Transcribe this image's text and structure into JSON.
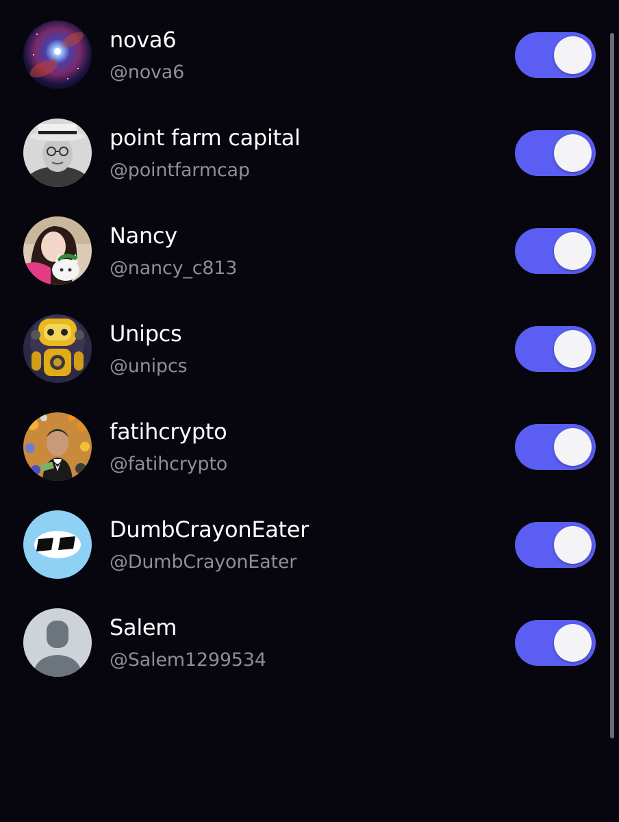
{
  "follows": [
    {
      "name": "nova6",
      "handle": "@nova6",
      "avatar": "galaxy-avatar",
      "enabled": true
    },
    {
      "name": "point farm capital",
      "handle": "@pointfarmcap",
      "avatar": "vintage-portrait-avatar",
      "enabled": true
    },
    {
      "name": "Nancy",
      "handle": "@nancy_c813",
      "avatar": "selfie-with-cat-avatar",
      "enabled": true
    },
    {
      "name": "Unipcs",
      "handle": "@unipcs",
      "avatar": "yellow-robot-avatar",
      "enabled": true
    },
    {
      "name": "fatihcrypto",
      "handle": "@fatihcrypto",
      "avatar": "godfather-crypto-avatar",
      "enabled": true
    },
    {
      "name": "DumbCrayonEater",
      "handle": "@DumbCrayonEater",
      "avatar": "cartoon-eyes-avatar",
      "enabled": true
    },
    {
      "name": "Salem",
      "handle": "@Salem1299534",
      "avatar": "default-person-avatar",
      "enabled": true
    }
  ],
  "colors": {
    "background": "#07060f",
    "toggle_on": "#5b5ef2",
    "knob": "#f4f4f6",
    "name_text": "#ffffff",
    "handle_text": "#8e8e96"
  }
}
